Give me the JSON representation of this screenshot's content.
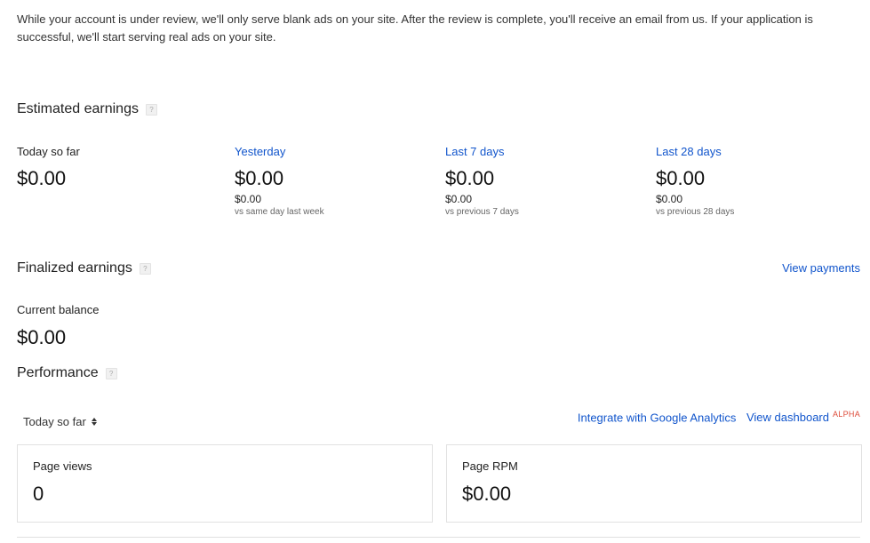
{
  "notice": "While your account is under review, we'll only serve blank ads on your site. After the review is complete, you'll receive an email from us. If your application is successful, we'll start serving real ads on your site.",
  "help_glyph": "?",
  "estimated": {
    "title": "Estimated earnings",
    "columns": [
      {
        "label": "Today so far",
        "value": "$0.00"
      },
      {
        "label": "Yesterday",
        "value": "$0.00",
        "previous": "$0.00",
        "compare": "vs same day last week"
      },
      {
        "label": "Last 7 days",
        "value": "$0.00",
        "previous": "$0.00",
        "compare": "vs previous 7 days"
      },
      {
        "label": "Last 28 days",
        "value": "$0.00",
        "previous": "$0.00",
        "compare": "vs previous 28 days"
      }
    ]
  },
  "finalized": {
    "title": "Finalized earnings",
    "view_payments": "View payments",
    "balance_label": "Current balance",
    "balance_value": "$0.00"
  },
  "performance": {
    "title": "Performance",
    "period": "Today so far",
    "integrate_link": "Integrate with Google Analytics",
    "dashboard_link": "View dashboard",
    "dashboard_badge": "ALPHA",
    "cards": [
      {
        "label": "Page views",
        "value": "0"
      },
      {
        "label": "Page RPM",
        "value": "$0.00"
      }
    ]
  }
}
